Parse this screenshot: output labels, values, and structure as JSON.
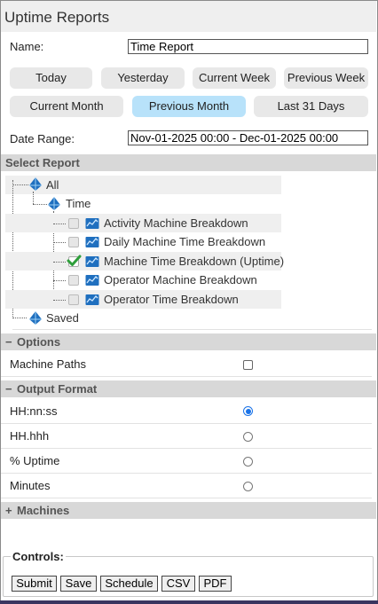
{
  "window": {
    "title": "Uptime Reports"
  },
  "form": {
    "name_label": "Name:",
    "name_value": "Time Report",
    "date_range_label": "Date Range:",
    "date_range_value": "Nov-01-2025 00:00 - Dec-01-2025 00:00"
  },
  "quick_ranges": {
    "today": "Today",
    "yesterday": "Yesterday",
    "current_week": "Current Week",
    "previous_week": "Previous Week",
    "current_month": "Current Month",
    "previous_month": "Previous Month",
    "last_31_days": "Last 31 Days",
    "selected": "Previous Month"
  },
  "select_report": {
    "header": "Select Report",
    "root": "All",
    "group": "Time",
    "items": [
      {
        "label": "Activity Machine Breakdown",
        "checked": false
      },
      {
        "label": "Daily Machine Time Breakdown",
        "checked": false
      },
      {
        "label": "Machine Time Breakdown (Uptime)",
        "checked": true
      },
      {
        "label": "Operator Machine Breakdown",
        "checked": false
      },
      {
        "label": "Operator Time Breakdown",
        "checked": false
      }
    ],
    "saved": "Saved"
  },
  "options": {
    "sign": "−",
    "header": "Options",
    "machine_paths_label": "Machine Paths",
    "machine_paths_checked": false
  },
  "output_format": {
    "sign": "−",
    "header": "Output Format",
    "choices": [
      "HH:nn:ss",
      "HH.hhh",
      "% Uptime",
      "Minutes"
    ],
    "selected": "HH:nn:ss"
  },
  "machines": {
    "sign": "+",
    "header": "Machines"
  },
  "controls": {
    "legend": "Controls:",
    "submit": "Submit",
    "save": "Save",
    "schedule": "Schedule",
    "csv": "CSV",
    "pdf": "PDF"
  },
  "colors": {
    "selected_pill": "#b8e2fa",
    "section_header": "#d8d8d8",
    "report_icon": "#1f6fbf",
    "check_green": "#2e9e3a"
  }
}
